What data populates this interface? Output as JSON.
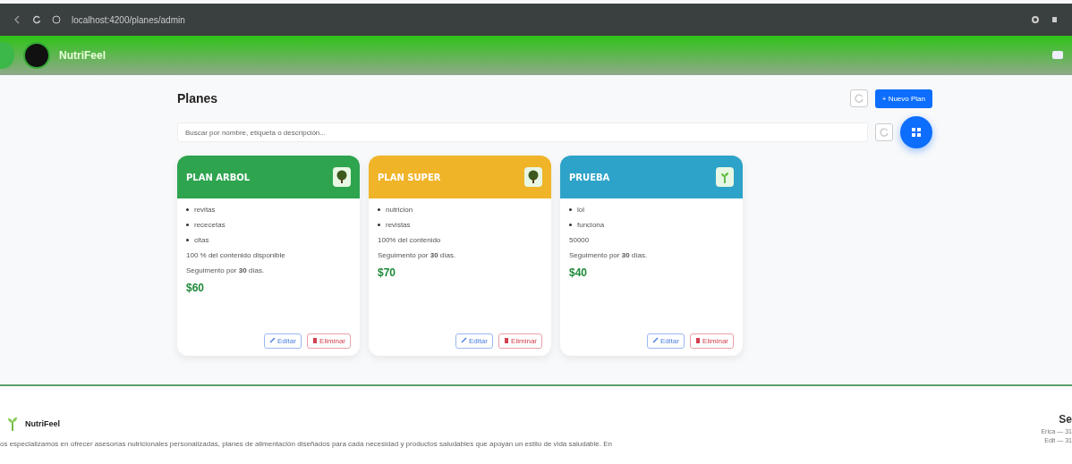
{
  "browser": {
    "url": "localhost:4200/planes/admin"
  },
  "header": {
    "brand": "NutriFeel"
  },
  "page": {
    "title": "Planes",
    "new_button": "+ Nuevo Plan",
    "search": {
      "placeholder": "Buscar por nombre, etiqueta o descripción..."
    }
  },
  "plans": [
    {
      "title": "PLAN ARBOL",
      "color": "#2ea44f",
      "kind": "tree",
      "features": [
        "revitas",
        "rececetas",
        "citas"
      ],
      "content": "100 % del contenido disponible",
      "tracking": "Seguimento por **30** días.",
      "price": "$60",
      "edit": "Editar",
      "delete": "Eliminar"
    },
    {
      "title": "PLAN SUPER",
      "color": "#f0b429",
      "kind": "tree",
      "features": [
        "nutricion",
        "revistas"
      ],
      "content": "100% del contenido",
      "tracking": "Seguimento por **30** días.",
      "price": "$70",
      "edit": "Editar",
      "delete": "Eliminar"
    },
    {
      "title": "PRUEBA",
      "color": "#2ea3c9",
      "kind": "sprout",
      "features": [
        "lol",
        "funciona"
      ],
      "content": "50000",
      "tracking": "Seguimento por **30** días.",
      "price": "$40",
      "edit": "Editar",
      "delete": "Eliminar"
    }
  ],
  "footer": {
    "brand": "NutriFeel",
    "description": "os especializamos en ofrecer asesorías nutricionales personalizadas, planes de alimentación diseñados para cada necesidad y productos saludables que apoyan un estilo de vida saludable. En",
    "side_heading": "Se",
    "side_lines": [
      "Erica — 31",
      "Edit — 31"
    ]
  }
}
